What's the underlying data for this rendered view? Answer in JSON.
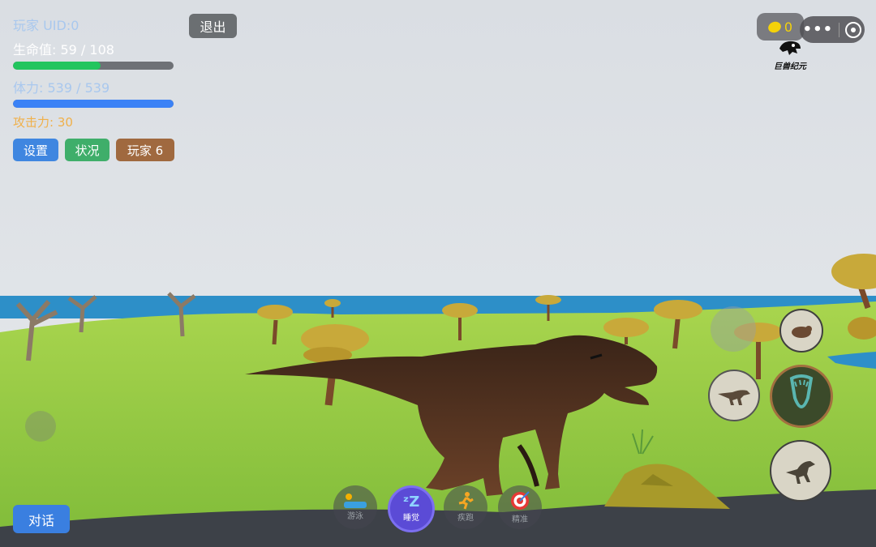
{
  "hud": {
    "player_line": "玩家  UID:0",
    "hp_text": "生命值: 59 / 108",
    "hp_fraction": 0.546,
    "stamina_text": "体力: 539 / 539",
    "stamina_fraction": 1.0,
    "attack_text": "攻击力: 30"
  },
  "buttons": {
    "settings": "设置",
    "status": "状况",
    "players": "玩家 6",
    "exit": "退出",
    "talk": "对话"
  },
  "coins": {
    "count": "0"
  },
  "logo_text": "巨兽纪元",
  "skills": [
    {
      "label": "游泳",
      "icon": "swim-icon"
    },
    {
      "label": "睡觉",
      "icon": "sleep-icon"
    },
    {
      "label": "疾跑",
      "icon": "sprint-icon"
    },
    {
      "label": "精准",
      "icon": "target-icon"
    }
  ],
  "action_buttons": [
    "crouch-dino-icon",
    "dash-dino-icon",
    "bite-jaw-icon",
    "jump-dino-icon",
    "rest-icon"
  ],
  "colors": {
    "hp": "#22c55e",
    "stamina": "#3b82f6",
    "attack": "#f0b04a",
    "settings_btn": "#3f86e0",
    "status_btn": "#3fae6a",
    "players_btn": "#a0693f"
  }
}
